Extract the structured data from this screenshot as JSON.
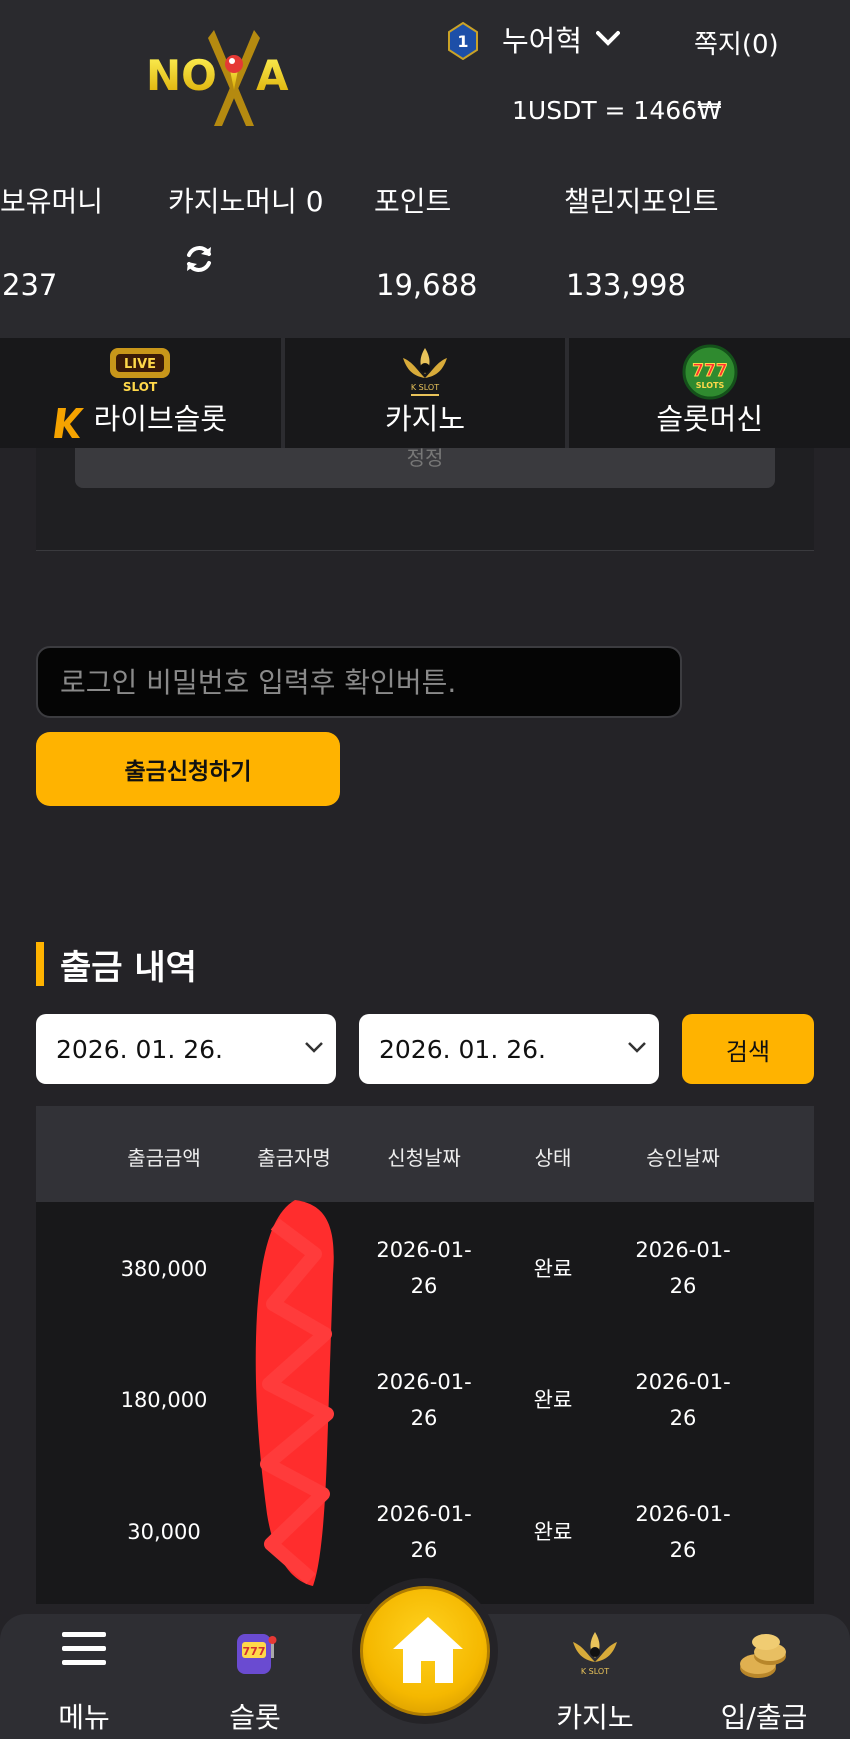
{
  "header": {
    "logo_text": "NOVA",
    "rank_level": "1",
    "username": "누어혁",
    "message_label": "쪽지(0)",
    "exchange_rate": "1USDT = 1466₩"
  },
  "balances": [
    {
      "label": "보유머니",
      "value": "237"
    },
    {
      "label": "카지노머니 0",
      "value": ""
    },
    {
      "label": "포인트",
      "value": "19,688"
    },
    {
      "label": "챌린지포인트",
      "value": "133,998"
    }
  ],
  "game_tabs": [
    {
      "label": "라이브슬롯",
      "icon": "live-slot-icon"
    },
    {
      "label": "카지노",
      "icon": "k-slot-icon"
    },
    {
      "label": "슬롯머신",
      "icon": "777-slots-icon"
    }
  ],
  "card": {
    "button_label": "정정"
  },
  "withdraw": {
    "password_placeholder": "로그인 비밀번호 입력후 확인버튼.",
    "submit_label": "출금신청하기"
  },
  "history": {
    "title": "출금 내역",
    "date_from": "2026. 01. 26.",
    "date_to": "2026. 01. 26.",
    "search_label": "검색",
    "columns": [
      "출금금액",
      "출금자명",
      "신청날짜",
      "상태",
      "승인날짜"
    ],
    "rows": [
      {
        "amount": "380,000",
        "name": "",
        "request_date_1": "2026-01-",
        "request_date_2": "26",
        "status": "완료",
        "approve_date_1": "2026-01-",
        "approve_date_2": "26"
      },
      {
        "amount": "180,000",
        "name": "",
        "request_date_1": "2026-01-",
        "request_date_2": "26",
        "status": "완료",
        "approve_date_1": "2026-01-",
        "approve_date_2": "26"
      },
      {
        "amount": "30,000",
        "name": "",
        "request_date_1": "2026-01-",
        "request_date_2": "26",
        "status": "완료",
        "approve_date_1": "2026-01-",
        "approve_date_2": "26"
      }
    ]
  },
  "bottom_nav": [
    {
      "label": "메뉴",
      "icon": "hamburger-icon"
    },
    {
      "label": "슬롯",
      "icon": "slot-machine-icon"
    },
    {
      "label": "",
      "icon": "home-icon"
    },
    {
      "label": "카지노",
      "icon": "k-slot-icon"
    },
    {
      "label": "입/출금",
      "icon": "coins-icon"
    }
  ],
  "colors": {
    "accent": "#ffb300",
    "background": "#242327",
    "header": "#2a2a2e",
    "redaction": "#ff2d2d"
  }
}
